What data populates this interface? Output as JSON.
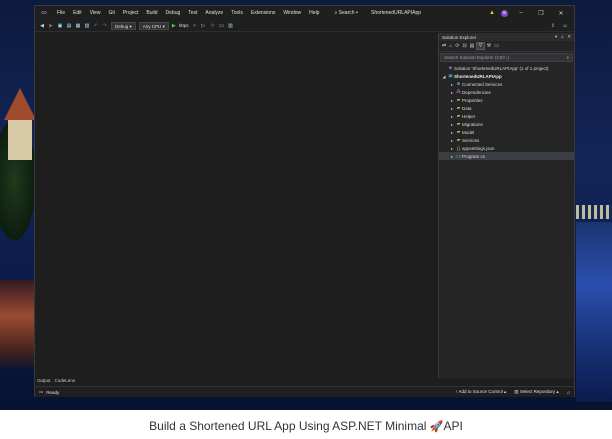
{
  "menubar": {
    "items": [
      "File",
      "Edit",
      "View",
      "Git",
      "Project",
      "Build",
      "Debug",
      "Test",
      "Analyze",
      "Tools",
      "Extensions",
      "Window",
      "Help"
    ],
    "search_label": "Search",
    "window_title": "ShortenedURLAPIApp",
    "avatar_initials": "RI"
  },
  "toolbar": {
    "configuration": "Debug",
    "platform": "Any CPU",
    "run_target": "https"
  },
  "solution_explorer": {
    "title": "Solution Explorer",
    "search_placeholder": "Search Solution Explorer (Ctrl+;)",
    "solution_label": "Solution 'ShortenedURLAPIApp' (1 of 1 project)",
    "project_label": "ShortenedURLAPIApp",
    "items": [
      {
        "label": "Connected Services",
        "icon": "connected-services-icon"
      },
      {
        "label": "Dependencies",
        "icon": "dependencies-icon"
      },
      {
        "label": "Properties",
        "icon": "folder-icon"
      },
      {
        "label": "Data",
        "icon": "folder-icon"
      },
      {
        "label": "Helper",
        "icon": "folder-icon"
      },
      {
        "label": "Migrations",
        "icon": "folder-icon"
      },
      {
        "label": "Model",
        "icon": "folder-icon"
      },
      {
        "label": "Services",
        "icon": "folder-icon"
      },
      {
        "label": "appsettings.json",
        "icon": "json-file-icon"
      },
      {
        "label": "Program.cs",
        "icon": "csharp-file-icon"
      }
    ]
  },
  "bottom_tabs": [
    "Output",
    "CodeLens"
  ],
  "statusbar": {
    "status": "Ready",
    "source_control": "Add to Source Control",
    "repository": "Select Repository"
  },
  "caption": {
    "text_before": "Build a Shortened URL App Using ASP.NET Minimal ",
    "text_after": "API"
  },
  "colors": {
    "ide_background": "#1e1e1e",
    "accent_purple": "#b180d7",
    "folder_yellow": "#dcb862"
  }
}
